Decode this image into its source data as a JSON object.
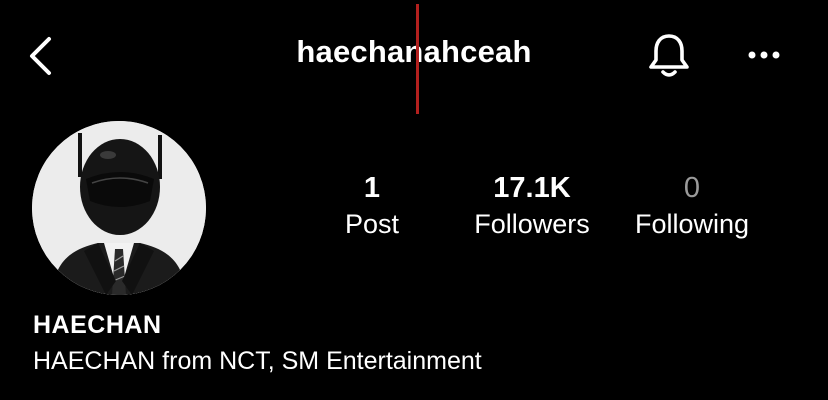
{
  "header": {
    "username": "haechanahceah",
    "icons": {
      "back": "chevron-left-icon",
      "notifications": "bell-icon",
      "more": "more-horizontal-icon"
    },
    "accent_line_color": "#b3201e"
  },
  "profile": {
    "display_name": "HAECHAN",
    "bio": "HAECHAN from NCT, SM Entertainment",
    "avatar": "profile-photo"
  },
  "stats": {
    "posts": {
      "value": "1",
      "label": "Post"
    },
    "followers": {
      "value": "17.1K",
      "label": "Followers"
    },
    "following": {
      "value": "0",
      "label": "Following"
    }
  }
}
